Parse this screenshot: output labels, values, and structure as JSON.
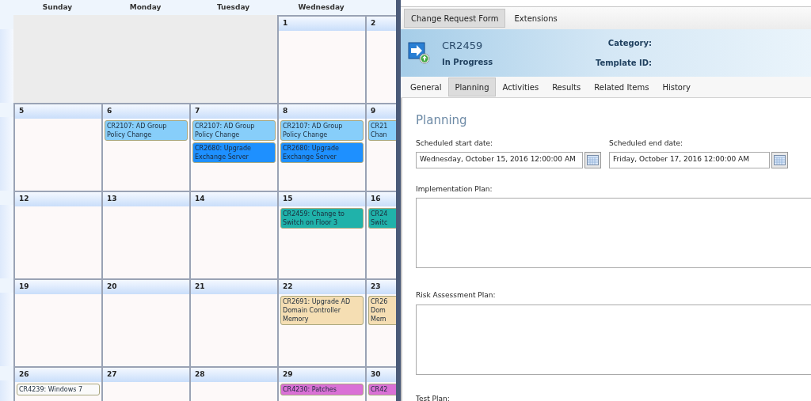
{
  "calendar": {
    "day_names": [
      "Sunday",
      "Monday",
      "Tuesday",
      "Wednesday"
    ],
    "weeks": [
      {
        "days": [
          {
            "kind": "outside"
          },
          {
            "kind": "outside"
          },
          {
            "kind": "outside"
          },
          {
            "kind": "day",
            "number": "1"
          },
          {
            "kind": "day",
            "number": "2"
          }
        ]
      },
      {
        "days": [
          {
            "kind": "day",
            "number": "5"
          },
          {
            "kind": "day",
            "number": "6",
            "events": [
              {
                "text": "CR2107: AD Group Policy Change",
                "color": "#87cefa"
              }
            ]
          },
          {
            "kind": "day",
            "number": "7",
            "events": [
              {
                "text": "CR2107: AD Group Policy Change",
                "color": "#87cefa"
              },
              {
                "text": "CR2680: Upgrade Exchange Server",
                "color": "#1e90ff"
              }
            ]
          },
          {
            "kind": "day",
            "number": "8",
            "events": [
              {
                "text": "CR2107: AD Group Policy Change",
                "color": "#87cefa"
              },
              {
                "text": "CR2680: Upgrade Exchange Server",
                "color": "#1e90ff"
              }
            ]
          },
          {
            "kind": "day",
            "number": "9",
            "events": [
              {
                "text": "CR21\nChan",
                "color": "#87cefa"
              }
            ]
          }
        ]
      },
      {
        "days": [
          {
            "kind": "day",
            "number": "12"
          },
          {
            "kind": "day",
            "number": "13"
          },
          {
            "kind": "day",
            "number": "14"
          },
          {
            "kind": "day",
            "number": "15",
            "events": [
              {
                "text": "CR2459: Change to Switch on Floor 3",
                "color": "#20b2aa"
              }
            ]
          },
          {
            "kind": "day",
            "number": "16",
            "events": [
              {
                "text": "CR24\nSwitc",
                "color": "#20b2aa"
              }
            ]
          }
        ]
      },
      {
        "days": [
          {
            "kind": "day",
            "number": "19"
          },
          {
            "kind": "day",
            "number": "20"
          },
          {
            "kind": "day",
            "number": "21"
          },
          {
            "kind": "day",
            "number": "22",
            "events": [
              {
                "text": "CR2691: Upgrade AD Domain Controller Memory",
                "color": "#f5deb3"
              }
            ]
          },
          {
            "kind": "day",
            "number": "23",
            "events": [
              {
                "text": "CR26\nDom\nMem",
                "color": "#f5deb3"
              }
            ]
          }
        ]
      },
      {
        "days": [
          {
            "kind": "day",
            "number": "26",
            "events": [
              {
                "text": "CR4239: Windows 7",
                "color": "#fafafa"
              }
            ]
          },
          {
            "kind": "day",
            "number": "27"
          },
          {
            "kind": "day",
            "number": "28"
          },
          {
            "kind": "day",
            "number": "29",
            "events": [
              {
                "text": "CR4230: Patches",
                "color": "#da70d6"
              }
            ]
          },
          {
            "kind": "day",
            "number": "30",
            "events": [
              {
                "text": "CR42",
                "color": "#da70d6"
              }
            ]
          }
        ]
      }
    ]
  },
  "form": {
    "tabs": [
      {
        "label": "Change Request Form",
        "selected": true
      },
      {
        "label": "Extensions",
        "selected": false
      }
    ],
    "header": {
      "id": "CR2459",
      "status": "In Progress",
      "fields": [
        "Category:",
        "Template ID:"
      ]
    },
    "subtabs": [
      {
        "label": "General",
        "selected": false
      },
      {
        "label": "Planning",
        "selected": true
      },
      {
        "label": "Activities",
        "selected": false
      },
      {
        "label": "Results",
        "selected": false
      },
      {
        "label": "Related Items",
        "selected": false
      },
      {
        "label": "History",
        "selected": false
      }
    ],
    "section_title": "Planning",
    "date_fields": [
      {
        "label": "Scheduled start date:",
        "value": "Wednesday, October 15, 2016 12:00:00 AM"
      },
      {
        "label": "Scheduled end date:",
        "value": "Friday, October 17, 2016 12:00:00 AM"
      }
    ],
    "text_areas": [
      {
        "label": "Implementation Plan:"
      },
      {
        "label": "Risk Assessment Plan:"
      }
    ],
    "trailing_label": "Test Plan:"
  }
}
